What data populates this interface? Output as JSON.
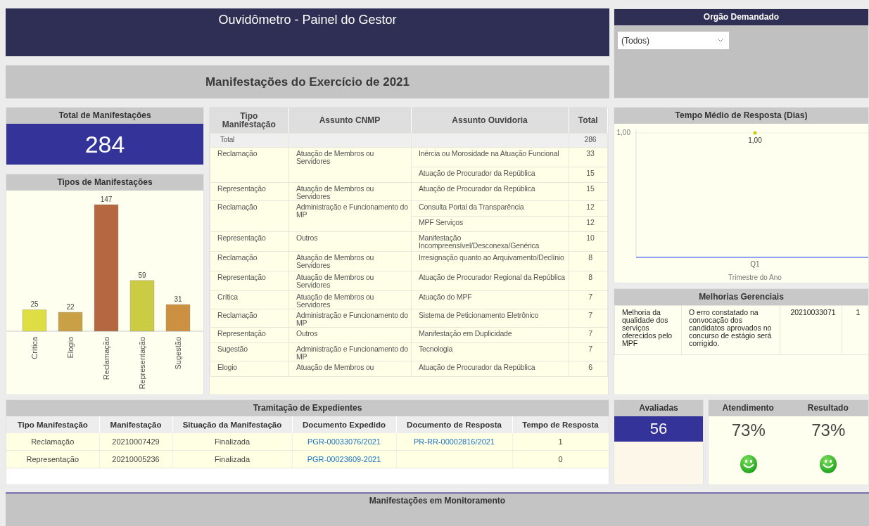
{
  "header": {
    "title": "Ouvidômetro - Painel do Gestor",
    "subtitle": "Manifestações do Exercício de 2021"
  },
  "filter": {
    "title": "Orgão Demandado",
    "value": "(Todos)"
  },
  "total": {
    "title": "Total de Manifestações",
    "value": "284"
  },
  "types_chart": {
    "title": "Tipos de Manifestações",
    "chart_data": {
      "type": "bar",
      "categories": [
        "Crítica",
        "Elogio",
        "Reclamação",
        "Representação",
        "Sugestão"
      ],
      "values": [
        25,
        22,
        147,
        59,
        31
      ],
      "data_labels": true
    }
  },
  "subjects_table": {
    "columns": [
      "Tipo Manifestação",
      "Assunto CNMP",
      "Assunto Ouvidoria",
      "Total"
    ],
    "total_row": {
      "label": "Total",
      "value": "286"
    },
    "groups": [
      {
        "tipo": "Reclamação",
        "assunto_cnmp": "Atuação de Membros ou Servidores",
        "items": [
          {
            "assunto": "Inércia ou Morosidade na Atuação Funcional",
            "total": "33"
          },
          {
            "assunto": "Atuação de Procurador da República",
            "total": "15"
          }
        ]
      },
      {
        "tipo": "Representação",
        "assunto_cnmp": "Atuação de Membros ou Servidores",
        "items": [
          {
            "assunto": "Atuação de Procurador da República",
            "total": "15"
          }
        ]
      },
      {
        "tipo": "Reclamação",
        "assunto_cnmp": "Administração e Funcionamento do MP",
        "items": [
          {
            "assunto": "Consulta Portal da Transparência",
            "total": "12"
          },
          {
            "assunto": "MPF Serviços",
            "total": "12"
          }
        ]
      },
      {
        "tipo": "Representação",
        "assunto_cnmp": "Outros",
        "items": [
          {
            "assunto": "Manifestação Incompreensível/Desconexa/Genérica",
            "total": "10"
          }
        ]
      },
      {
        "tipo": "Reclamação",
        "assunto_cnmp": "Atuação de Membros ou Servidores",
        "items": [
          {
            "assunto": "Irresignação quanto ao Arquivamento/Declínio",
            "total": "8"
          }
        ]
      },
      {
        "tipo": "Representação",
        "assunto_cnmp": "Atuação de Membros ou Servidores",
        "items": [
          {
            "assunto": "Atuação de Procurador Regional da República",
            "total": "8"
          }
        ]
      },
      {
        "tipo": "Crítica",
        "assunto_cnmp": "Atuação de Membros ou Servidores",
        "items": [
          {
            "assunto": "Atuação do MPF",
            "total": "7"
          }
        ]
      },
      {
        "tipo": "Reclamação",
        "assunto_cnmp": "Administração e Funcionamento do MP",
        "items": [
          {
            "assunto": "Sistema de Peticionamento Eletrônico",
            "total": "7"
          }
        ]
      },
      {
        "tipo": "Representação",
        "assunto_cnmp": "Outros",
        "items": [
          {
            "assunto": "Manifestação em Duplicidade",
            "total": "7"
          }
        ]
      },
      {
        "tipo": "Sugestão",
        "assunto_cnmp": "Administração e Funcionamento do MP",
        "items": [
          {
            "assunto": "Tecnologia",
            "total": "7"
          }
        ]
      },
      {
        "tipo": "Elogio",
        "assunto_cnmp": "Atuação de Membros ou",
        "items": [
          {
            "assunto": "Atuação de Procurador da República",
            "total": "6"
          }
        ]
      }
    ]
  },
  "response_chart": {
    "title": "Tempo Médio de Resposta (Dias)",
    "y_axis_label": "1,00",
    "point_label": "1,00",
    "x_axis_label": "Q1",
    "x_axis_title": "Trimestre do Ano"
  },
  "improvements": {
    "title": "Melhorias Gerenciais",
    "rows": [
      [
        "Melhoria da qualidade dos serviços oferecidos pelo MPF",
        "O erro constatado na convocação dos candidatos aprovados no concurso de estágio será corrigido.",
        "20210033071",
        "1"
      ]
    ]
  },
  "tramitacao": {
    "title": "Tramitação de Expedientes",
    "columns": [
      "Tipo Manifestação",
      "Manifestação",
      "Situação da Manifestação",
      "Documento Expedido",
      "Documento de Resposta",
      "Tempo de Resposta"
    ],
    "rows": [
      [
        {
          "kind": "text",
          "text": "Reclamação"
        },
        {
          "kind": "text",
          "text": "20210007429"
        },
        {
          "kind": "text",
          "text": "Finalizada"
        },
        {
          "kind": "link",
          "text": "PGR-00033076/2021"
        },
        {
          "kind": "link",
          "text": "PR-RR-00002816/2021"
        },
        {
          "kind": "text",
          "text": "1"
        }
      ],
      [
        {
          "kind": "text",
          "text": "Representação"
        },
        {
          "kind": "text",
          "text": "20210005236"
        },
        {
          "kind": "text",
          "text": "Finalizada"
        },
        {
          "kind": "link",
          "text": "PGR-00023609-2021"
        },
        {
          "kind": "empty"
        },
        {
          "kind": "text",
          "text": "0"
        }
      ]
    ]
  },
  "satisfaction": {
    "evaluated": {
      "title": "Avaliadas",
      "value": "56"
    },
    "metrics": [
      {
        "title": "Atendimento",
        "value": "73%",
        "satisfied": true
      },
      {
        "title": "Resultado",
        "value": "73%",
        "satisfied": true
      }
    ]
  },
  "monitoring": {
    "title": "Manifestações em Monitoramento"
  }
}
